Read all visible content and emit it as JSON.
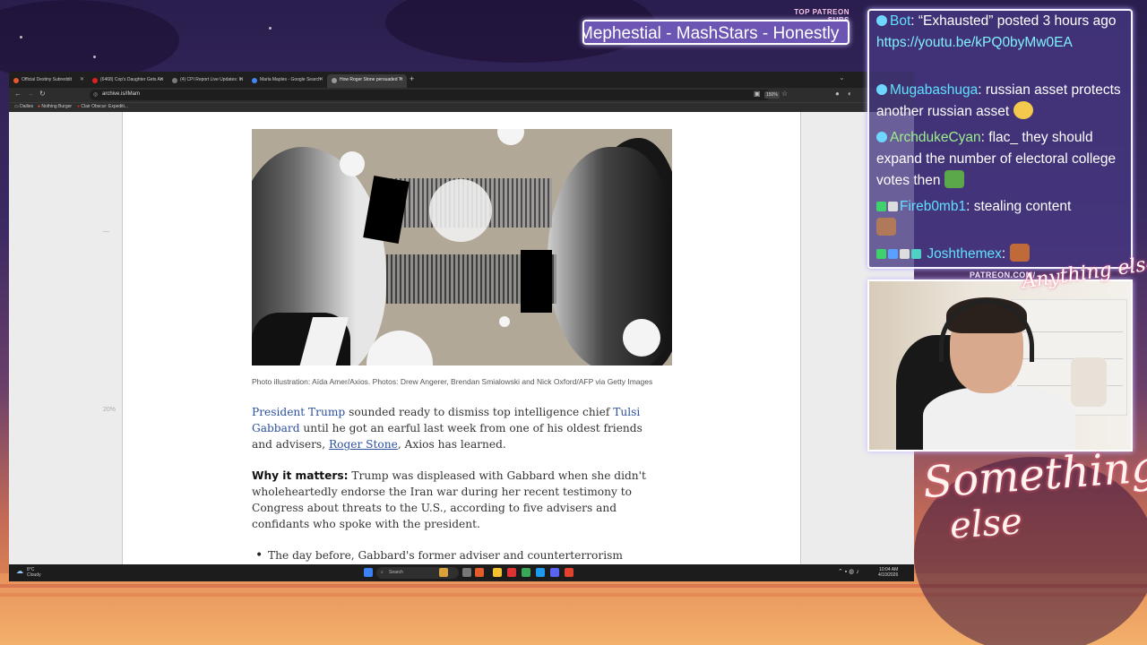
{
  "overlay": {
    "top_patreon_label": "TOP PATREON SUBS",
    "top_patreon_ticker": "Mephestial - MashStars - Honestly",
    "patreon_url": "PATREON.COM/",
    "cam_logo": "Anything else",
    "brand_line1": "Something",
    "brand_line2": "else"
  },
  "chat": {
    "messages": [
      {
        "user": "Bot",
        "text": ": “Exhausted” posted 3 hours ago",
        "link": "https://youtu.be/kPQ0byMw0EA"
      },
      {
        "user": "Mugabashuga",
        "text": ": russian asset protects another russian asset"
      },
      {
        "user": "ArchdukeCyan",
        "text": ": flac_ they should expand the number of electoral college votes then"
      },
      {
        "user": "Fireb0mb1",
        "text": ": stealing content"
      },
      {
        "user": "Joshthemex",
        "text": ":"
      }
    ]
  },
  "browser": {
    "tabs": [
      {
        "label": "Official Destiny Subreddit",
        "favicon_color": "#e8572a"
      },
      {
        "label": "(6468) Cop's Daughter Gets An",
        "favicon_color": "#e02020"
      },
      {
        "label": "(4) CPI Report Live Updates: In",
        "favicon_color": "#7a7a7a"
      },
      {
        "label": "Marla Maples - Google Search",
        "favicon_color": "#4285f4"
      },
      {
        "label": "How Roger Stone persuaded Tr",
        "favicon_color": "#999999"
      }
    ],
    "url": "archive.is/IMam",
    "zoom": "150%",
    "bookmarks": [
      "Dailies",
      "Nothing Burger",
      "Clair Obscur: Expediti..."
    ]
  },
  "page": {
    "side_marker_1": "—",
    "side_marker_2": "20%",
    "caption": "Photo illustration: Aïda Amer/Axios. Photos: Drew Angerer, Brendan Smialowski and Nick Oxford/AFP via Getty Images",
    "p1_link1": "President Trump",
    "p1_text1": " sounded ready to dismiss top intelligence chief ",
    "p1_link2": "Tulsi Gabbard",
    "p1_text2": " until he got an earful last week from one of his oldest friends and advisers, ",
    "p1_link3": "Roger Stone",
    "p1_text3": ", Axios has learned.",
    "p2_bold": "Why it matters:",
    "p2_text": " Trump was displeased with Gabbard when she didn't wholeheartedly endorse the Iran war during her recent testimony to Congress about threats to the U.S., according to five advisers and confidants who spoke with the president.",
    "bullet1": "The day before, Gabbard's former adviser and counterterrorism director,"
  },
  "taskbar": {
    "weather_temp": "8°C",
    "weather_desc": "Cloudy",
    "search": "Search",
    "time": "10:04 AM",
    "date": "4/10/2026"
  }
}
